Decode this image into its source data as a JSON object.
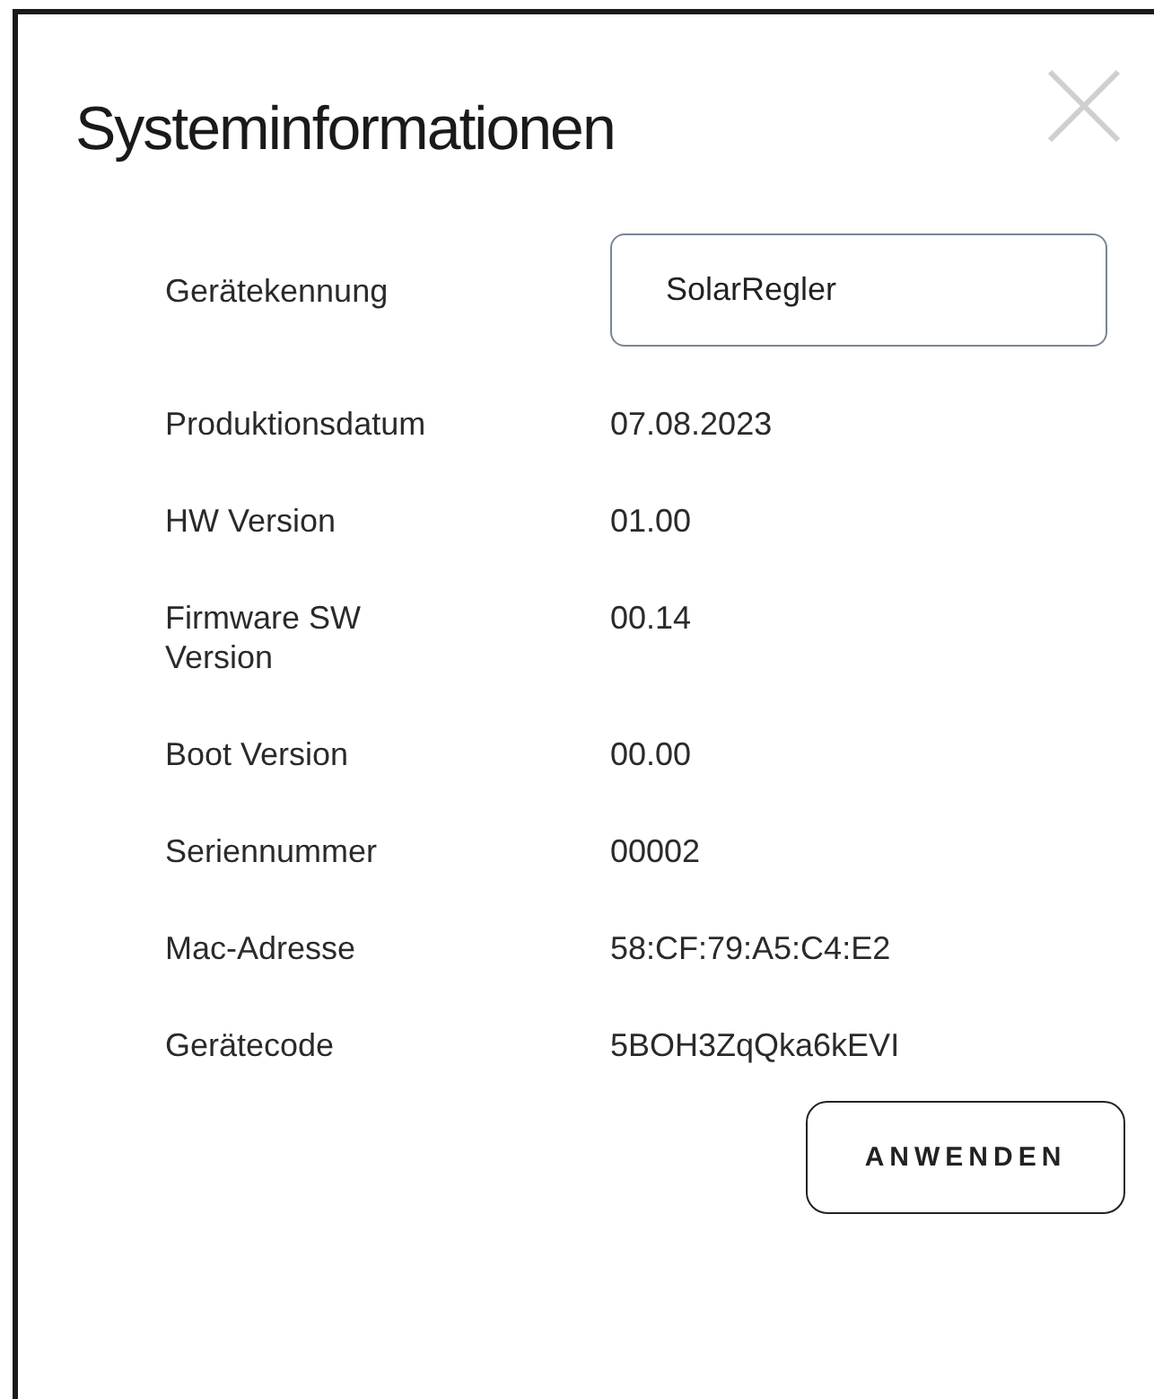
{
  "dialog": {
    "title": "Systeminformationen",
    "fields": [
      {
        "kind": "input",
        "label": "Gerätekennung",
        "value": "SolarRegler"
      },
      {
        "kind": "text",
        "label": "Produktionsdatum",
        "value": "07.08.2023"
      },
      {
        "kind": "text",
        "label": "HW Version",
        "value": "01.00"
      },
      {
        "kind": "text",
        "label": "Firmware SW Version",
        "value": "00.14"
      },
      {
        "kind": "text",
        "label": "Boot Version",
        "value": "00.00"
      },
      {
        "kind": "text",
        "label": "Seriennummer",
        "value": "00002"
      },
      {
        "kind": "text",
        "label": "Mac-Adresse",
        "value": "58:CF:79:A5:C4:E2"
      },
      {
        "kind": "text",
        "label": "Gerätecode",
        "value": "5BOH3ZqQka6kEVI"
      }
    ],
    "button": "ANWENDEN"
  }
}
